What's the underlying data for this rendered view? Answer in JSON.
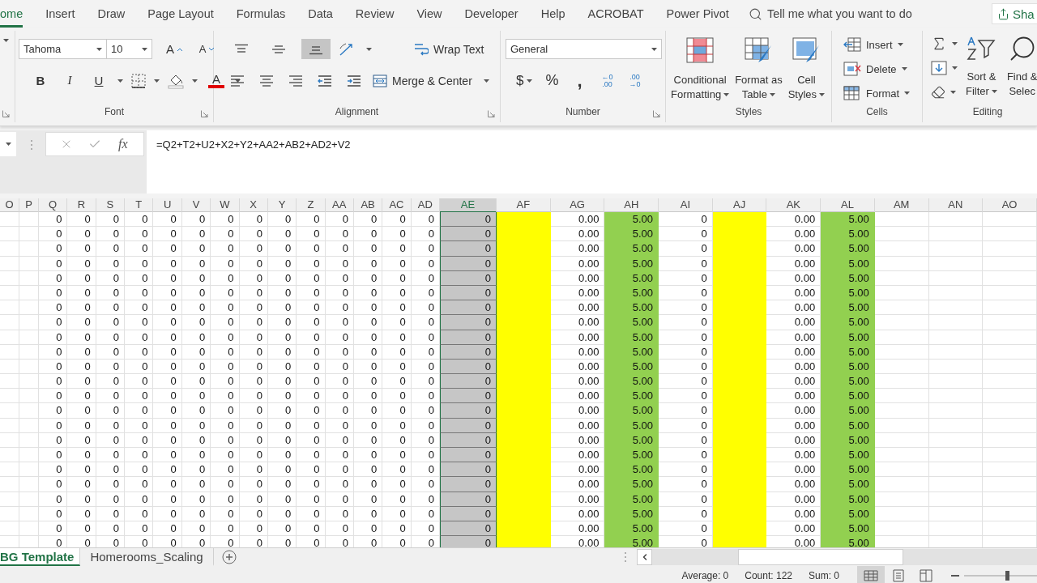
{
  "ribbon_tabs": [
    {
      "label": "ome",
      "selected": true
    },
    {
      "label": "Insert",
      "selected": false
    },
    {
      "label": "Draw",
      "selected": false
    },
    {
      "label": "Page Layout",
      "selected": false
    },
    {
      "label": "Formulas",
      "selected": false
    },
    {
      "label": "Data",
      "selected": false
    },
    {
      "label": "Review",
      "selected": false
    },
    {
      "label": "View",
      "selected": false
    },
    {
      "label": "Developer",
      "selected": false
    },
    {
      "label": "Help",
      "selected": false
    },
    {
      "label": "ACROBAT",
      "selected": false
    },
    {
      "label": "Power Pivot",
      "selected": false
    }
  ],
  "tell_me": {
    "placeholder": "Tell me what you want to do"
  },
  "share_button": "Sha",
  "font_group": {
    "label": "Font",
    "font_name": "Tahoma",
    "font_size": "10",
    "grow_font": "A",
    "shrink_font": "A",
    "bold": "B",
    "italic": "I",
    "underline": "U",
    "font_color": "A"
  },
  "alignment_group": {
    "label": "Alignment",
    "vertical_align": [
      {
        "selected": false
      },
      {
        "selected": false
      },
      {
        "selected": true
      }
    ],
    "wrap_text": "Wrap Text",
    "merge_center": "Merge & Center"
  },
  "number_group": {
    "label": "Number",
    "format": "General",
    "currency": "$",
    "percent": "%",
    "comma": ",",
    "decrease_decimal": [
      "←0",
      ".00"
    ],
    "increase_decimal": [
      ".00",
      "→0"
    ]
  },
  "styles_group": {
    "label": "Styles",
    "buttons": [
      [
        "Conditional",
        "Formatting"
      ],
      [
        "Format as",
        "Table"
      ],
      [
        "Cell",
        "Styles"
      ]
    ]
  },
  "cells_group": {
    "label": "Cells",
    "buttons": [
      "Insert",
      "Delete",
      "Format"
    ]
  },
  "editing_group": {
    "label": "Editing",
    "buttons": [
      [
        "Sort &",
        "Filter"
      ],
      [
        "Find &",
        "Selec"
      ]
    ]
  },
  "formula_bar": {
    "fx": "fx",
    "formula": "=Q2+T2+U2+X2+Y2+AA2+AB2+AD2+V2"
  },
  "sheet": {
    "columns": [
      {
        "header": "O",
        "selected": false
      },
      {
        "header": "P",
        "selected": false
      },
      {
        "header": "Q",
        "selected": false
      },
      {
        "header": "R",
        "selected": false
      },
      {
        "header": "S",
        "selected": false
      },
      {
        "header": "T",
        "selected": false
      },
      {
        "header": "U",
        "selected": false
      },
      {
        "header": "V",
        "selected": false
      },
      {
        "header": "W",
        "selected": false
      },
      {
        "header": "X",
        "selected": false
      },
      {
        "header": "Y",
        "selected": false
      },
      {
        "header": "Z",
        "selected": false
      },
      {
        "header": "AA",
        "selected": false
      },
      {
        "header": "AB",
        "selected": false
      },
      {
        "header": "AC",
        "selected": false
      },
      {
        "header": "AD",
        "selected": false
      },
      {
        "header": "AE",
        "selected": true
      },
      {
        "header": "AF",
        "selected": false,
        "color": "#ffff00"
      },
      {
        "header": "AG",
        "selected": false
      },
      {
        "header": "AH",
        "selected": false,
        "color": "#92d050"
      },
      {
        "header": "AI",
        "selected": false
      },
      {
        "header": "AJ",
        "selected": false,
        "color": "#ffff00"
      },
      {
        "header": "AK",
        "selected": false
      },
      {
        "header": "AL",
        "selected": false,
        "color": "#92d050"
      },
      {
        "header": "AM",
        "selected": false
      },
      {
        "header": "AN",
        "selected": false
      },
      {
        "header": "AO",
        "selected": false
      }
    ],
    "rows": [
      [
        null,
        null,
        "0",
        "0",
        "0",
        "0",
        "0",
        "0",
        "0",
        "0",
        "0",
        "0",
        "0",
        "0",
        "0",
        "0",
        "0",
        null,
        "0.00",
        "5.00",
        "0",
        null,
        "0.00",
        "5.00",
        null,
        null,
        null
      ],
      [
        null,
        null,
        "0",
        "0",
        "0",
        "0",
        "0",
        "0",
        "0",
        "0",
        "0",
        "0",
        "0",
        "0",
        "0",
        "0",
        "0",
        null,
        "0.00",
        "5.00",
        "0",
        null,
        "0.00",
        "5.00",
        null,
        null,
        null
      ],
      [
        null,
        null,
        "0",
        "0",
        "0",
        "0",
        "0",
        "0",
        "0",
        "0",
        "0",
        "0",
        "0",
        "0",
        "0",
        "0",
        "0",
        null,
        "0.00",
        "5.00",
        "0",
        null,
        "0.00",
        "5.00",
        null,
        null,
        null
      ],
      [
        null,
        null,
        "0",
        "0",
        "0",
        "0",
        "0",
        "0",
        "0",
        "0",
        "0",
        "0",
        "0",
        "0",
        "0",
        "0",
        "0",
        null,
        "0.00",
        "5.00",
        "0",
        null,
        "0.00",
        "5.00",
        null,
        null,
        null
      ],
      [
        null,
        null,
        "0",
        "0",
        "0",
        "0",
        "0",
        "0",
        "0",
        "0",
        "0",
        "0",
        "0",
        "0",
        "0",
        "0",
        "0",
        null,
        "0.00",
        "5.00",
        "0",
        null,
        "0.00",
        "5.00",
        null,
        null,
        null
      ],
      [
        null,
        null,
        "0",
        "0",
        "0",
        "0",
        "0",
        "0",
        "0",
        "0",
        "0",
        "0",
        "0",
        "0",
        "0",
        "0",
        "0",
        null,
        "0.00",
        "5.00",
        "0",
        null,
        "0.00",
        "5.00",
        null,
        null,
        null
      ],
      [
        null,
        null,
        "0",
        "0",
        "0",
        "0",
        "0",
        "0",
        "0",
        "0",
        "0",
        "0",
        "0",
        "0",
        "0",
        "0",
        "0",
        null,
        "0.00",
        "5.00",
        "0",
        null,
        "0.00",
        "5.00",
        null,
        null,
        null
      ],
      [
        null,
        null,
        "0",
        "0",
        "0",
        "0",
        "0",
        "0",
        "0",
        "0",
        "0",
        "0",
        "0",
        "0",
        "0",
        "0",
        "0",
        null,
        "0.00",
        "5.00",
        "0",
        null,
        "0.00",
        "5.00",
        null,
        null,
        null
      ],
      [
        null,
        null,
        "0",
        "0",
        "0",
        "0",
        "0",
        "0",
        "0",
        "0",
        "0",
        "0",
        "0",
        "0",
        "0",
        "0",
        "0",
        null,
        "0.00",
        "5.00",
        "0",
        null,
        "0.00",
        "5.00",
        null,
        null,
        null
      ],
      [
        null,
        null,
        "0",
        "0",
        "0",
        "0",
        "0",
        "0",
        "0",
        "0",
        "0",
        "0",
        "0",
        "0",
        "0",
        "0",
        "0",
        null,
        "0.00",
        "5.00",
        "0",
        null,
        "0.00",
        "5.00",
        null,
        null,
        null
      ],
      [
        null,
        null,
        "0",
        "0",
        "0",
        "0",
        "0",
        "0",
        "0",
        "0",
        "0",
        "0",
        "0",
        "0",
        "0",
        "0",
        "0",
        null,
        "0.00",
        "5.00",
        "0",
        null,
        "0.00",
        "5.00",
        null,
        null,
        null
      ],
      [
        null,
        null,
        "0",
        "0",
        "0",
        "0",
        "0",
        "0",
        "0",
        "0",
        "0",
        "0",
        "0",
        "0",
        "0",
        "0",
        "0",
        null,
        "0.00",
        "5.00",
        "0",
        null,
        "0.00",
        "5.00",
        null,
        null,
        null
      ],
      [
        null,
        null,
        "0",
        "0",
        "0",
        "0",
        "0",
        "0",
        "0",
        "0",
        "0",
        "0",
        "0",
        "0",
        "0",
        "0",
        "0",
        null,
        "0.00",
        "5.00",
        "0",
        null,
        "0.00",
        "5.00",
        null,
        null,
        null
      ],
      [
        null,
        null,
        "0",
        "0",
        "0",
        "0",
        "0",
        "0",
        "0",
        "0",
        "0",
        "0",
        "0",
        "0",
        "0",
        "0",
        "0",
        null,
        "0.00",
        "5.00",
        "0",
        null,
        "0.00",
        "5.00",
        null,
        null,
        null
      ],
      [
        null,
        null,
        "0",
        "0",
        "0",
        "0",
        "0",
        "0",
        "0",
        "0",
        "0",
        "0",
        "0",
        "0",
        "0",
        "0",
        "0",
        null,
        "0.00",
        "5.00",
        "0",
        null,
        "0.00",
        "5.00",
        null,
        null,
        null
      ],
      [
        null,
        null,
        "0",
        "0",
        "0",
        "0",
        "0",
        "0",
        "0",
        "0",
        "0",
        "0",
        "0",
        "0",
        "0",
        "0",
        "0",
        null,
        "0.00",
        "5.00",
        "0",
        null,
        "0.00",
        "5.00",
        null,
        null,
        null
      ],
      [
        null,
        null,
        "0",
        "0",
        "0",
        "0",
        "0",
        "0",
        "0",
        "0",
        "0",
        "0",
        "0",
        "0",
        "0",
        "0",
        "0",
        null,
        "0.00",
        "5.00",
        "0",
        null,
        "0.00",
        "5.00",
        null,
        null,
        null
      ],
      [
        null,
        null,
        "0",
        "0",
        "0",
        "0",
        "0",
        "0",
        "0",
        "0",
        "0",
        "0",
        "0",
        "0",
        "0",
        "0",
        "0",
        null,
        "0.00",
        "5.00",
        "0",
        null,
        "0.00",
        "5.00",
        null,
        null,
        null
      ],
      [
        null,
        null,
        "0",
        "0",
        "0",
        "0",
        "0",
        "0",
        "0",
        "0",
        "0",
        "0",
        "0",
        "0",
        "0",
        "0",
        "0",
        null,
        "0.00",
        "5.00",
        "0",
        null,
        "0.00",
        "5.00",
        null,
        null,
        null
      ],
      [
        null,
        null,
        "0",
        "0",
        "0",
        "0",
        "0",
        "0",
        "0",
        "0",
        "0",
        "0",
        "0",
        "0",
        "0",
        "0",
        "0",
        null,
        "0.00",
        "5.00",
        "0",
        null,
        "0.00",
        "5.00",
        null,
        null,
        null
      ],
      [
        null,
        null,
        "0",
        "0",
        "0",
        "0",
        "0",
        "0",
        "0",
        "0",
        "0",
        "0",
        "0",
        "0",
        "0",
        "0",
        "0",
        null,
        "0.00",
        "5.00",
        "0",
        null,
        "0.00",
        "5.00",
        null,
        null,
        null
      ],
      [
        null,
        null,
        "0",
        "0",
        "0",
        "0",
        "0",
        "0",
        "0",
        "0",
        "0",
        "0",
        "0",
        "0",
        "0",
        "0",
        "0",
        null,
        "0.00",
        "5.00",
        "0",
        null,
        "0.00",
        "5.00",
        null,
        null,
        null
      ],
      [
        null,
        null,
        "0",
        "0",
        "0",
        "0",
        "0",
        "0",
        "0",
        "0",
        "0",
        "0",
        "0",
        "0",
        "0",
        "0",
        "0",
        null,
        "0.00",
        "5.00",
        "0",
        null,
        "0.00",
        "5.00",
        null,
        null,
        null
      ]
    ]
  },
  "sheet_tabs": [
    {
      "label": "BG Template",
      "selected": true
    },
    {
      "label": "Homerooms_Scaling",
      "selected": false
    }
  ],
  "status_bar": {
    "average": "Average: 0",
    "count": "Count: 122",
    "sum": "Sum: 0",
    "zoom_slider": {
      "level": 0.6
    }
  }
}
